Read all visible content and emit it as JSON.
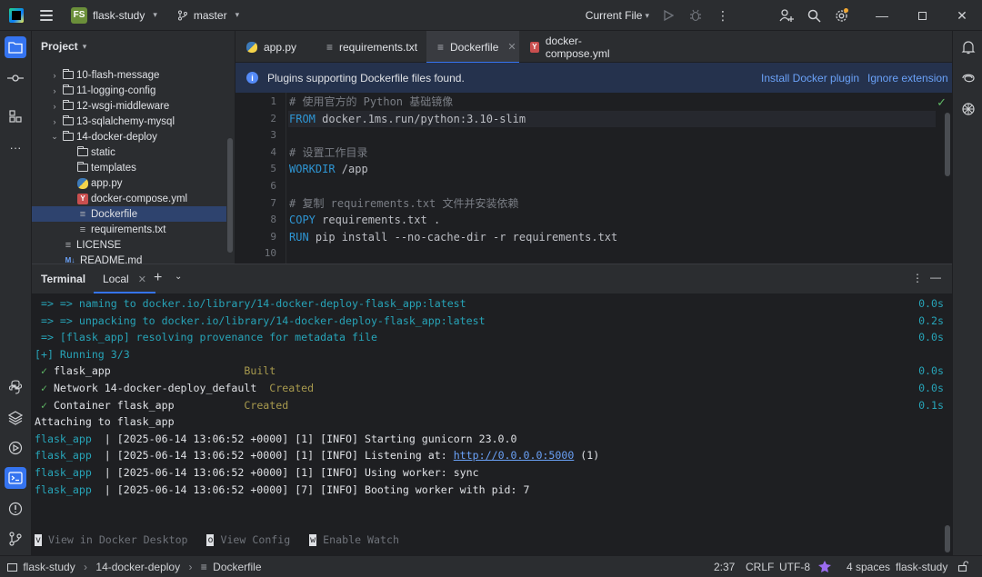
{
  "titlebar": {
    "project_badge": "FS",
    "project_name": "flask-study",
    "branch": "master",
    "run_config": "Current File"
  },
  "project_panel": {
    "title": "Project",
    "items": [
      {
        "label": "10-flash-message",
        "type": "folder",
        "indent": 1,
        "expanded": false
      },
      {
        "label": "11-logging-config",
        "type": "folder",
        "indent": 1,
        "expanded": false
      },
      {
        "label": "12-wsgi-middleware",
        "type": "folder",
        "indent": 1,
        "expanded": false
      },
      {
        "label": "13-sqlalchemy-mysql",
        "type": "folder",
        "indent": 1,
        "expanded": false
      },
      {
        "label": "14-docker-deploy",
        "type": "folder",
        "indent": 1,
        "expanded": true
      },
      {
        "label": "static",
        "type": "folder",
        "indent": 2
      },
      {
        "label": "templates",
        "type": "folder",
        "indent": 2
      },
      {
        "label": "app.py",
        "type": "python",
        "indent": 2
      },
      {
        "label": "docker-compose.yml",
        "type": "yaml",
        "indent": 2
      },
      {
        "label": "Dockerfile",
        "type": "text",
        "indent": 2,
        "selected": true
      },
      {
        "label": "requirements.txt",
        "type": "text",
        "indent": 2
      },
      {
        "label": "LICENSE",
        "type": "text",
        "indent": 1
      },
      {
        "label": "README.md",
        "type": "markdown",
        "indent": 1
      }
    ]
  },
  "tabs": [
    {
      "label": "app.py",
      "icon": "python-file-icon",
      "active": false
    },
    {
      "label": "requirements.txt",
      "icon": "text-file-icon",
      "active": false
    },
    {
      "label": "Dockerfile",
      "icon": "text-file-icon",
      "active": true
    },
    {
      "label": "docker-compose.yml",
      "icon": "yaml-file-icon",
      "active": false
    }
  ],
  "banner": {
    "message": "Plugins supporting Dockerfile files found.",
    "install_link": "Install Docker plugin",
    "ignore_link": "Ignore extension"
  },
  "editor": {
    "lines": [
      {
        "n": "1",
        "parts": [
          {
            "t": "# 使用官方的 Python 基础镜像",
            "c": "comment"
          }
        ]
      },
      {
        "n": "2",
        "parts": [
          {
            "t": "FROM",
            "c": "kw"
          },
          {
            "t": " docker.1ms.run/python:3.10-slim",
            "c": "plain"
          }
        ],
        "current": true
      },
      {
        "n": "3",
        "parts": []
      },
      {
        "n": "4",
        "parts": [
          {
            "t": "# 设置工作目录",
            "c": "comment"
          }
        ]
      },
      {
        "n": "5",
        "parts": [
          {
            "t": "WORKDIR",
            "c": "kw"
          },
          {
            "t": " /app",
            "c": "plain"
          }
        ]
      },
      {
        "n": "6",
        "parts": []
      },
      {
        "n": "7",
        "parts": [
          {
            "t": "# 复制 requirements.txt 文件并安装依赖",
            "c": "comment"
          }
        ]
      },
      {
        "n": "8",
        "parts": [
          {
            "t": "COPY",
            "c": "kw"
          },
          {
            "t": " requirements.txt .",
            "c": "plain"
          }
        ]
      },
      {
        "n": "9",
        "parts": [
          {
            "t": "RUN",
            "c": "kw"
          },
          {
            "t": " pip install --no-cache-dir -r requirements.txt",
            "c": "plain"
          }
        ]
      },
      {
        "n": "10",
        "parts": []
      }
    ]
  },
  "terminal": {
    "title": "Terminal",
    "tab_label": "Local",
    "lines": [
      {
        "parts": [
          {
            "t": " => => naming to docker.io/library/14-docker-deploy-flask_app:latest",
            "c": "cyan"
          }
        ],
        "time": "0.0s"
      },
      {
        "parts": [
          {
            "t": " => => unpacking to docker.io/library/14-docker-deploy-flask_app:latest",
            "c": "cyan"
          }
        ],
        "time": "0.2s"
      },
      {
        "parts": [
          {
            "t": " => [flask_app] resolving provenance for metadata file",
            "c": "cyan"
          }
        ],
        "time": "0.0s"
      },
      {
        "parts": [
          {
            "t": "[+] Running 3/3",
            "c": "cyan"
          }
        ],
        "time": ""
      },
      {
        "parts": [
          {
            "t": " ✓",
            "c": "green"
          },
          {
            "t": " flask_app                     ",
            "c": "plain"
          },
          {
            "t": "Built",
            "c": "olive"
          }
        ],
        "time": "0.0s"
      },
      {
        "parts": [
          {
            "t": " ✓",
            "c": "green"
          },
          {
            "t": " Network 14-docker-deploy_default  ",
            "c": "plain"
          },
          {
            "t": "Created",
            "c": "olive"
          }
        ],
        "time": "0.0s"
      },
      {
        "parts": [
          {
            "t": " ✓",
            "c": "green"
          },
          {
            "t": " Container flask_app           ",
            "c": "plain"
          },
          {
            "t": "Created",
            "c": "olive"
          }
        ],
        "time": "0.1s"
      },
      {
        "parts": [
          {
            "t": "Attaching to flask_app",
            "c": "plain"
          }
        ],
        "time": ""
      },
      {
        "parts": [
          {
            "t": "flask_app",
            "c": "cyan"
          },
          {
            "t": "  | [2025-06-14 13:06:52 +0000] [1] [INFO] Starting gunicorn 23.0.0",
            "c": "plain"
          }
        ],
        "time": ""
      },
      {
        "parts": [
          {
            "t": "flask_app",
            "c": "cyan"
          },
          {
            "t": "  | [2025-06-14 13:06:52 +0000] [1] [INFO] Listening at: ",
            "c": "plain"
          },
          {
            "t": "http://0.0.0.0:5000",
            "c": "link"
          },
          {
            "t": " (1)",
            "c": "plain"
          }
        ],
        "time": ""
      },
      {
        "parts": [
          {
            "t": "flask_app",
            "c": "cyan"
          },
          {
            "t": "  | [2025-06-14 13:06:52 +0000] [1] [INFO] Using worker: sync",
            "c": "plain"
          }
        ],
        "time": ""
      },
      {
        "parts": [
          {
            "t": "flask_app",
            "c": "cyan"
          },
          {
            "t": "  | [2025-06-14 13:06:52 +0000] [7] [INFO] Booting worker with pid: 7",
            "c": "plain"
          }
        ],
        "time": ""
      }
    ],
    "shortcuts": [
      {
        "key": "v",
        "label": "View in Docker Desktop"
      },
      {
        "key": "o",
        "label": "View Config"
      },
      {
        "key": "w",
        "label": "Enable Watch"
      }
    ]
  },
  "statusbar": {
    "breadcrumb": [
      "flask-study",
      "14-docker-deploy",
      "Dockerfile"
    ],
    "position": "2:37",
    "line_sep": "CRLF",
    "encoding": "UTF-8",
    "indent": "4 spaces",
    "project": "flask-study"
  }
}
